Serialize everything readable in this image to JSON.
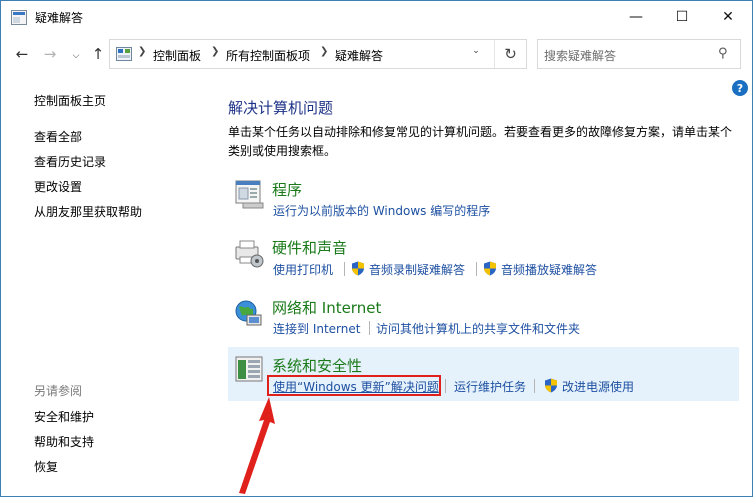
{
  "window": {
    "title": "疑难解答",
    "controls": {
      "minimize": "—",
      "maximize": "☐",
      "close": "✕"
    }
  },
  "address": {
    "breadcrumbs": [
      "控制面板",
      "所有控制面板项",
      "疑难解答"
    ],
    "search_placeholder": "搜索疑难解答"
  },
  "left_nav": {
    "items": [
      "控制面板主页",
      "查看全部",
      "查看历史记录",
      "更改设置",
      "从朋友那里获取帮助"
    ],
    "see_also_label": "另请参阅",
    "see_also_items": [
      "安全和维护",
      "帮助和支持",
      "恢复"
    ]
  },
  "main": {
    "title": "解决计算机问题",
    "description": "单击某个任务以自动排除和修复常见的计算机问题。若要查看更多的故障修复方案，请单击某个类别或使用搜索框。",
    "categories": [
      {
        "title": "程序",
        "icon": "programs-icon",
        "links": [
          "运行为以前版本的 Windows 编写的程序"
        ]
      },
      {
        "title": "硬件和声音",
        "icon": "hardware-sound-icon",
        "links": [
          "使用打印机",
          "音频录制疑难解答",
          "音频播放疑难解答"
        ]
      },
      {
        "title": "网络和 Internet",
        "icon": "network-icon",
        "links": [
          "连接到 Internet",
          "访问其他计算机上的共享文件和文件夹"
        ]
      },
      {
        "title": "系统和安全性",
        "icon": "system-security-icon",
        "links": [
          "使用“Windows 更新”解决问题",
          "运行维护任务",
          "改进电源使用"
        ],
        "highlighted": true
      }
    ]
  },
  "colors": {
    "category_title": "#1a7a1a",
    "link": "#1e50a2",
    "heading": "#1e3287",
    "highlight_bg": "#e5f1fb",
    "annotation_red": "#e0201b"
  }
}
